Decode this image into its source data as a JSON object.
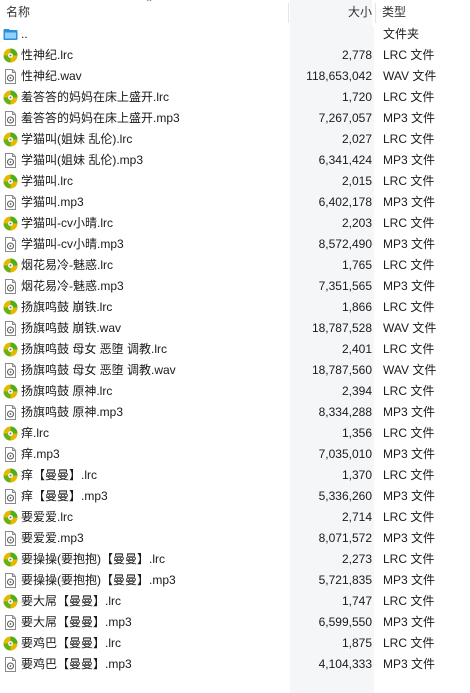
{
  "header": {
    "name_label": "名称",
    "size_label": "大小",
    "type_label": "类型"
  },
  "files": [
    {
      "name": "..",
      "size": "",
      "type": "文件夹",
      "icon": "parent-folder-icon"
    },
    {
      "name": "性神纪.lrc",
      "size": "2,778",
      "type": "LRC 文件",
      "icon": "lrc-icon"
    },
    {
      "name": "性神纪.wav",
      "size": "118,653,042",
      "type": "WAV 文件",
      "icon": "audio-file-icon"
    },
    {
      "name": "羞答答的妈妈在床上盛开.lrc",
      "size": "1,720",
      "type": "LRC 文件",
      "icon": "lrc-icon"
    },
    {
      "name": "羞答答的妈妈在床上盛开.mp3",
      "size": "7,267,057",
      "type": "MP3 文件",
      "icon": "audio-file-icon"
    },
    {
      "name": "学猫叫(姐妹 乱伦).lrc",
      "size": "2,027",
      "type": "LRC 文件",
      "icon": "lrc-icon"
    },
    {
      "name": "学猫叫(姐妹 乱伦).mp3",
      "size": "6,341,424",
      "type": "MP3 文件",
      "icon": "audio-file-icon"
    },
    {
      "name": "学猫叫.lrc",
      "size": "2,015",
      "type": "LRC 文件",
      "icon": "lrc-icon"
    },
    {
      "name": "学猫叫.mp3",
      "size": "6,402,178",
      "type": "MP3 文件",
      "icon": "audio-file-icon"
    },
    {
      "name": "学猫叫-cv小晴.lrc",
      "size": "2,203",
      "type": "LRC 文件",
      "icon": "lrc-icon"
    },
    {
      "name": "学猫叫-cv小晴.mp3",
      "size": "8,572,490",
      "type": "MP3 文件",
      "icon": "audio-file-icon"
    },
    {
      "name": "烟花易冷-魅惑.lrc",
      "size": "1,765",
      "type": "LRC 文件",
      "icon": "lrc-icon"
    },
    {
      "name": "烟花易冷-魅惑.mp3",
      "size": "7,351,565",
      "type": "MP3 文件",
      "icon": "audio-file-icon"
    },
    {
      "name": "扬旗鸣鼓 崩铁.lrc",
      "size": "1,866",
      "type": "LRC 文件",
      "icon": "lrc-icon"
    },
    {
      "name": "扬旗鸣鼓 崩铁.wav",
      "size": "18,787,528",
      "type": "WAV 文件",
      "icon": "audio-file-icon"
    },
    {
      "name": "扬旗鸣鼓 母女 恶堕 调教.lrc",
      "size": "2,401",
      "type": "LRC 文件",
      "icon": "lrc-icon"
    },
    {
      "name": "扬旗鸣鼓 母女 恶堕 调教.wav",
      "size": "18,787,560",
      "type": "WAV 文件",
      "icon": "audio-file-icon"
    },
    {
      "name": "扬旗鸣鼓 原神.lrc",
      "size": "2,394",
      "type": "LRC 文件",
      "icon": "lrc-icon"
    },
    {
      "name": "扬旗鸣鼓 原神.mp3",
      "size": "8,334,288",
      "type": "MP3 文件",
      "icon": "audio-file-icon"
    },
    {
      "name": "痒.lrc",
      "size": "1,356",
      "type": "LRC 文件",
      "icon": "lrc-icon"
    },
    {
      "name": "痒.mp3",
      "size": "7,035,010",
      "type": "MP3 文件",
      "icon": "audio-file-icon"
    },
    {
      "name": "痒【曼曼】.lrc",
      "size": "1,370",
      "type": "LRC 文件",
      "icon": "lrc-icon"
    },
    {
      "name": "痒【曼曼】.mp3",
      "size": "5,336,260",
      "type": "MP3 文件",
      "icon": "audio-file-icon"
    },
    {
      "name": "要爱爱.lrc",
      "size": "2,714",
      "type": "LRC 文件",
      "icon": "lrc-icon"
    },
    {
      "name": "要爱爱.mp3",
      "size": "8,071,572",
      "type": "MP3 文件",
      "icon": "audio-file-icon"
    },
    {
      "name": "要操操(要抱抱)【曼曼】.lrc",
      "size": "2,273",
      "type": "LRC 文件",
      "icon": "lrc-icon"
    },
    {
      "name": "要操操(要抱抱)【曼曼】.mp3",
      "size": "5,721,835",
      "type": "MP3 文件",
      "icon": "audio-file-icon"
    },
    {
      "name": "要大屌【曼曼】.lrc",
      "size": "1,747",
      "type": "LRC 文件",
      "icon": "lrc-icon"
    },
    {
      "name": "要大屌【曼曼】.mp3",
      "size": "6,599,550",
      "type": "MP3 文件",
      "icon": "audio-file-icon"
    },
    {
      "name": "要鸡巴【曼曼】.lrc",
      "size": "1,875",
      "type": "LRC 文件",
      "icon": "lrc-icon"
    },
    {
      "name": "要鸡巴【曼曼】.mp3",
      "size": "4,104,333",
      "type": "MP3 文件",
      "icon": "audio-file-icon"
    }
  ],
  "colors": {
    "size_column_bg": "#f4f6f8",
    "lrc_icon_yellow": "#e6b800",
    "lrc_icon_green": "#4caf1c",
    "folder_blue": "#2f8fd6"
  }
}
